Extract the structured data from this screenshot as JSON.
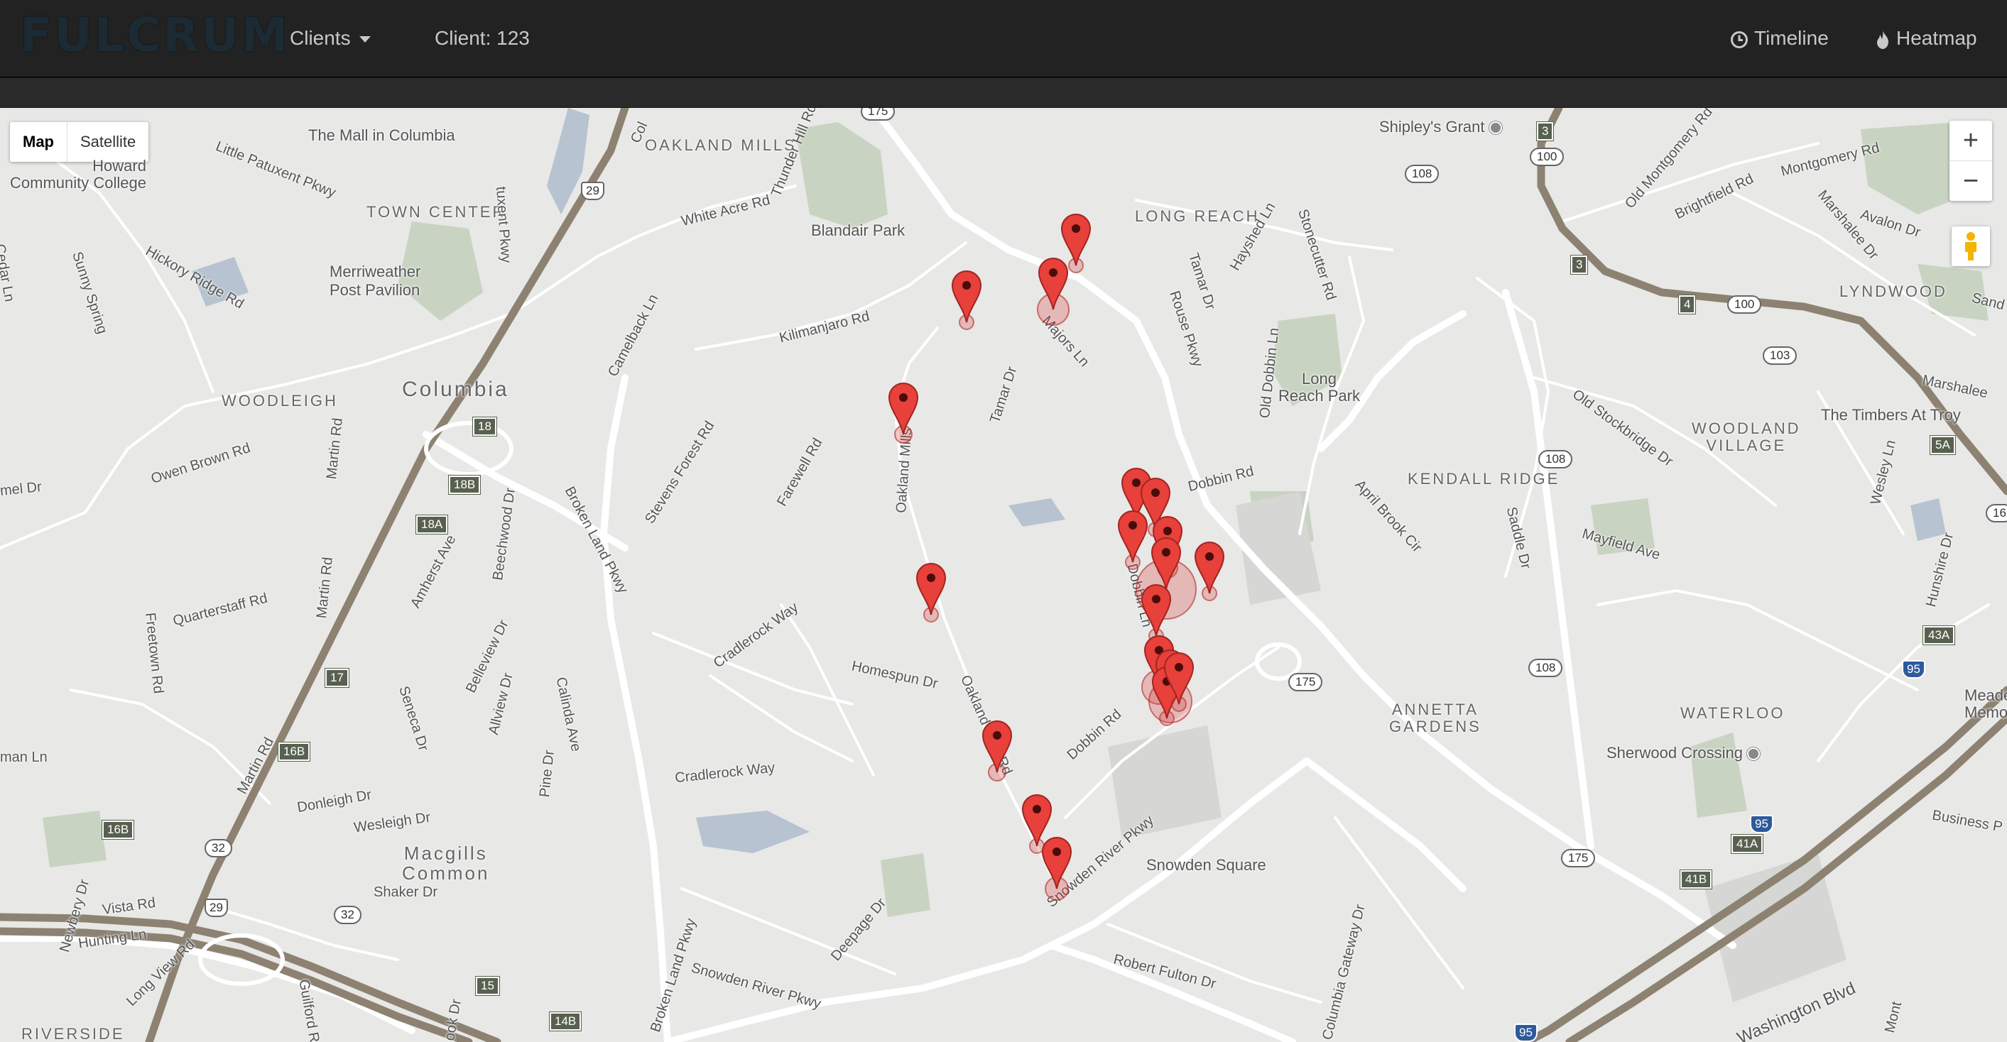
{
  "navbar": {
    "brand": "FULCRUM",
    "clients_menu": "Clients",
    "client_label": "Client: 123",
    "timeline": "Timeline",
    "heatmap": "Heatmap"
  },
  "map_controls": {
    "map_type_map": "Map",
    "map_type_satellite": "Satellite",
    "zoom_in": "+",
    "zoom_out": "−",
    "street_view_icon": "pegman-icon"
  },
  "map_labels": {
    "mall": "The Mall in Columbia",
    "howard_cc": "Howard\nCommunity College",
    "oakland_mills": "OAKLAND MILLS",
    "town_center": "TOWN CENTER",
    "little_patuxent": "Little Patuxent Pkwy",
    "cedar_ln": "Cedar Ln",
    "sunny_spring": "Sunny Spring",
    "hickory_ridge": "Hickory Ridge Rd",
    "merriweather": "Merriweather\nPost Pavilion",
    "white_acre": "White Acre Rd",
    "thunder_hill": "Thunder Hill Rd",
    "blandair": "Blandair Park",
    "long_reach": "LONG REACH",
    "shipleys": "Shipley's Grant",
    "kilimanjaro": "Kilimanjaro Rd",
    "camelback": "Camelback Ln",
    "majors": "Majors Ln",
    "tamar1": "Tamar Dr",
    "tamar2": "Tamar Dr",
    "rouse": "Rouse Pkwy",
    "hayshed": "Hayshed Ln",
    "stonecutter": "Stonecutter Rd",
    "old_dobbin": "Old Dobbin Ln",
    "long_reach_park": "Long\nReach Park",
    "old_montgomery": "Old Montgomery Rd",
    "montgomery": "Montgomery Rd",
    "brightfield": "Brightfield Rd",
    "marshalee": "Marshalee Dr",
    "avalon": "Avalon Dr",
    "lyndwood": "LYNDWOOD",
    "sand": "Sand",
    "marshalee2": "Marshalee",
    "columbia": "Columbia",
    "woodleigh": "WOODLEIGH",
    "martin1": "Martin Rd",
    "owen_brown": "Owen Brown Rd",
    "mel": "mel Dr",
    "stevens_forest": "Stevens Forest Rd",
    "farewell": "Farewell Rd",
    "oakland_mills_rd": "Oakland Mills",
    "broken_land": "Broken Land Pkwy",
    "old_stockbridge": "Old Stockbridge Dr",
    "woodland_village": "WOODLAND\nVILLAGE",
    "timbers": "The Timbers At Troy",
    "dobbin_rd": "Dobbin Rd",
    "kendall_ridge": "KENDALL RIDGE",
    "april_brook": "April Brook Cir",
    "saddle": "Saddle Dr",
    "mayfield": "Mayfield Ave",
    "wesley": "Wesley Ln",
    "hunshire": "Hunshire Dr",
    "beechwood": "Beechwood Dr",
    "amherst": "Amherst Ave",
    "martin2": "Martin Rd",
    "quarterstaff": "Quarterstaff Rd",
    "freetown": "Freetown Rd",
    "cradlerock_way1": "Cradlerock Way",
    "dobbin_ln": "Dobbin Ln",
    "homespun": "Homespun Dr",
    "oakland_mills_rd2": "Oakland Mills Rd",
    "belleview": "Belleview Dr",
    "allview": "Allview Dr",
    "calinda": "Calinda Ave",
    "seneca": "Seneca Dr",
    "annetta": "ANNETTA\nGARDENS",
    "waterloo": "WATERLOO",
    "meade": "Meade\nMemor",
    "sherwood": "Sherwood Crossing",
    "dobbin_rd2": "Dobbin Rd",
    "cradlerock_way2": "Cradlerock Way",
    "pine": "Pine Dr",
    "man_ln": "man Ln",
    "martin3": "Martin Rd",
    "donleigh": "Donleigh Dr",
    "wesleigh": "Wesleigh Dr",
    "business": "Business P",
    "macgills": "Macgills\nCommon",
    "shaker": "Shaker Dr",
    "snowden_pkwy1": "Snowden River Pkwy",
    "snowden_square": "Snowden Square",
    "newbery": "Newbery Dr",
    "vista": "Vista Rd",
    "hunting": "Hunting Ln",
    "long_view": "Long View Rd",
    "deepage": "Deepage Dr",
    "columbia_gateway": "Columbia Gateway Dr",
    "robert_fulton": "Robert Fulton Dr",
    "snowden_pkwy2": "Snowden River Pkwy",
    "broken_land2": "Broken Land Pkwy",
    "guilford": "Guilford Rd",
    "riverside": "RIVERSIDE",
    "ook_dr": "ook Dr",
    "washington_blvd": "Washington Blvd",
    "mont": "Mont",
    "patuxent_pkwy": "tuxent Pkwy",
    "col_label": "Col"
  },
  "shields": [
    "175",
    "29",
    "18",
    "18B",
    "18A",
    "17",
    "16B",
    "16B",
    "32",
    "29",
    "32",
    "15",
    "14B",
    "3",
    "100",
    "108",
    "3",
    "4",
    "100",
    "103",
    "108",
    "5A",
    "43A",
    "95",
    "41A",
    "95",
    "41B",
    "175",
    "175",
    "108",
    "95",
    "16"
  ]
}
